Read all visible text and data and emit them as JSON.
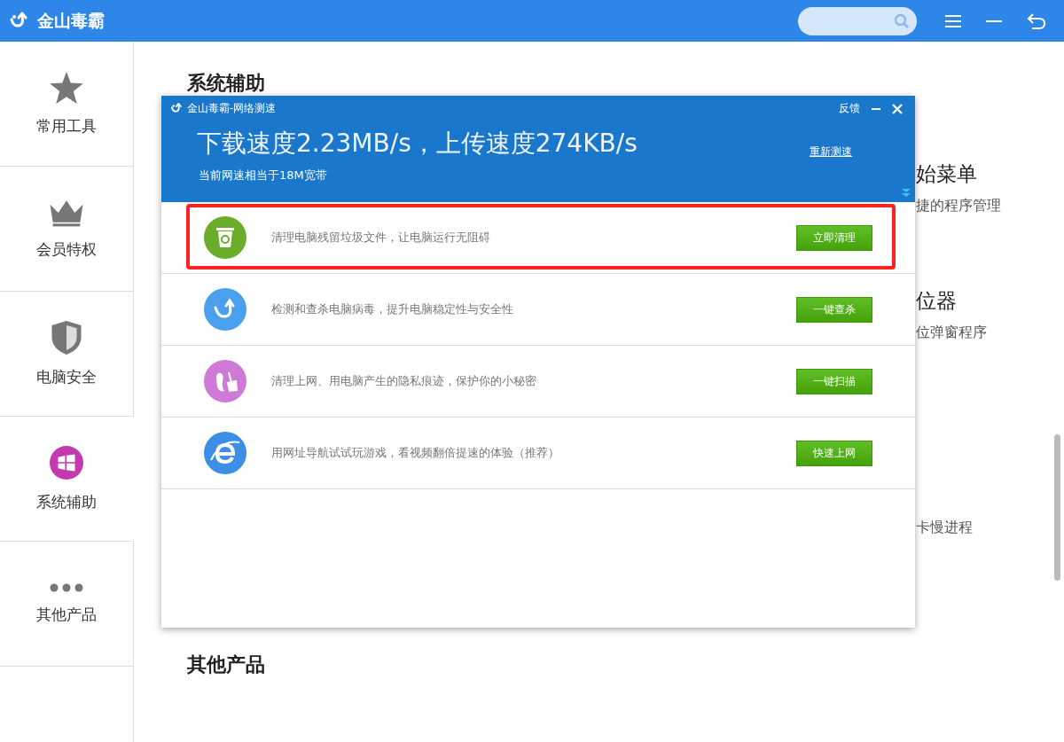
{
  "app": {
    "title": "金山毒霸"
  },
  "sidebar": {
    "items": [
      {
        "label": "常用工具",
        "kind": "star",
        "selected": false
      },
      {
        "label": "会员特权",
        "kind": "crown",
        "selected": false
      },
      {
        "label": "电脑安全",
        "kind": "shield",
        "selected": false
      },
      {
        "label": "系统辅助",
        "kind": "windows",
        "selected": true
      },
      {
        "label": "其他产品",
        "kind": "dots",
        "selected": false
      }
    ]
  },
  "content": {
    "section_1": "系统辅助",
    "right_items": [
      {
        "title": "始菜单",
        "desc": "捷的程序管理"
      },
      {
        "title": "位器",
        "desc": "位弹窗程序"
      },
      {
        "desc": "卡慢进程"
      }
    ],
    "section_2": "其他产品"
  },
  "dialog": {
    "title": "金山毒霸-网络测速",
    "feedback": "反馈",
    "speed": "下载速度2.23MB/s，上传速度274KB/s",
    "bandwidth": "当前网速相当于18M宽带",
    "retest": "重新测速",
    "rows": [
      {
        "kind": "trash",
        "text": "清理电脑残留垃圾文件，让电脑运行无阻碍",
        "button": "立即清理",
        "highlighted": true
      },
      {
        "kind": "logo",
        "text": "检测和查杀电脑病毒，提升电脑稳定性与安全性",
        "button": "一键查杀",
        "highlighted": false
      },
      {
        "kind": "privacy",
        "text": "清理上网、用电脑产生的隐私痕迹，保护你的小秘密",
        "button": "一键扫描",
        "highlighted": false
      },
      {
        "kind": "browser",
        "text": "用网址导航试试玩游戏，看视频翻倍提速的体验（推荐）",
        "button": "快速上网",
        "highlighted": false
      }
    ]
  }
}
